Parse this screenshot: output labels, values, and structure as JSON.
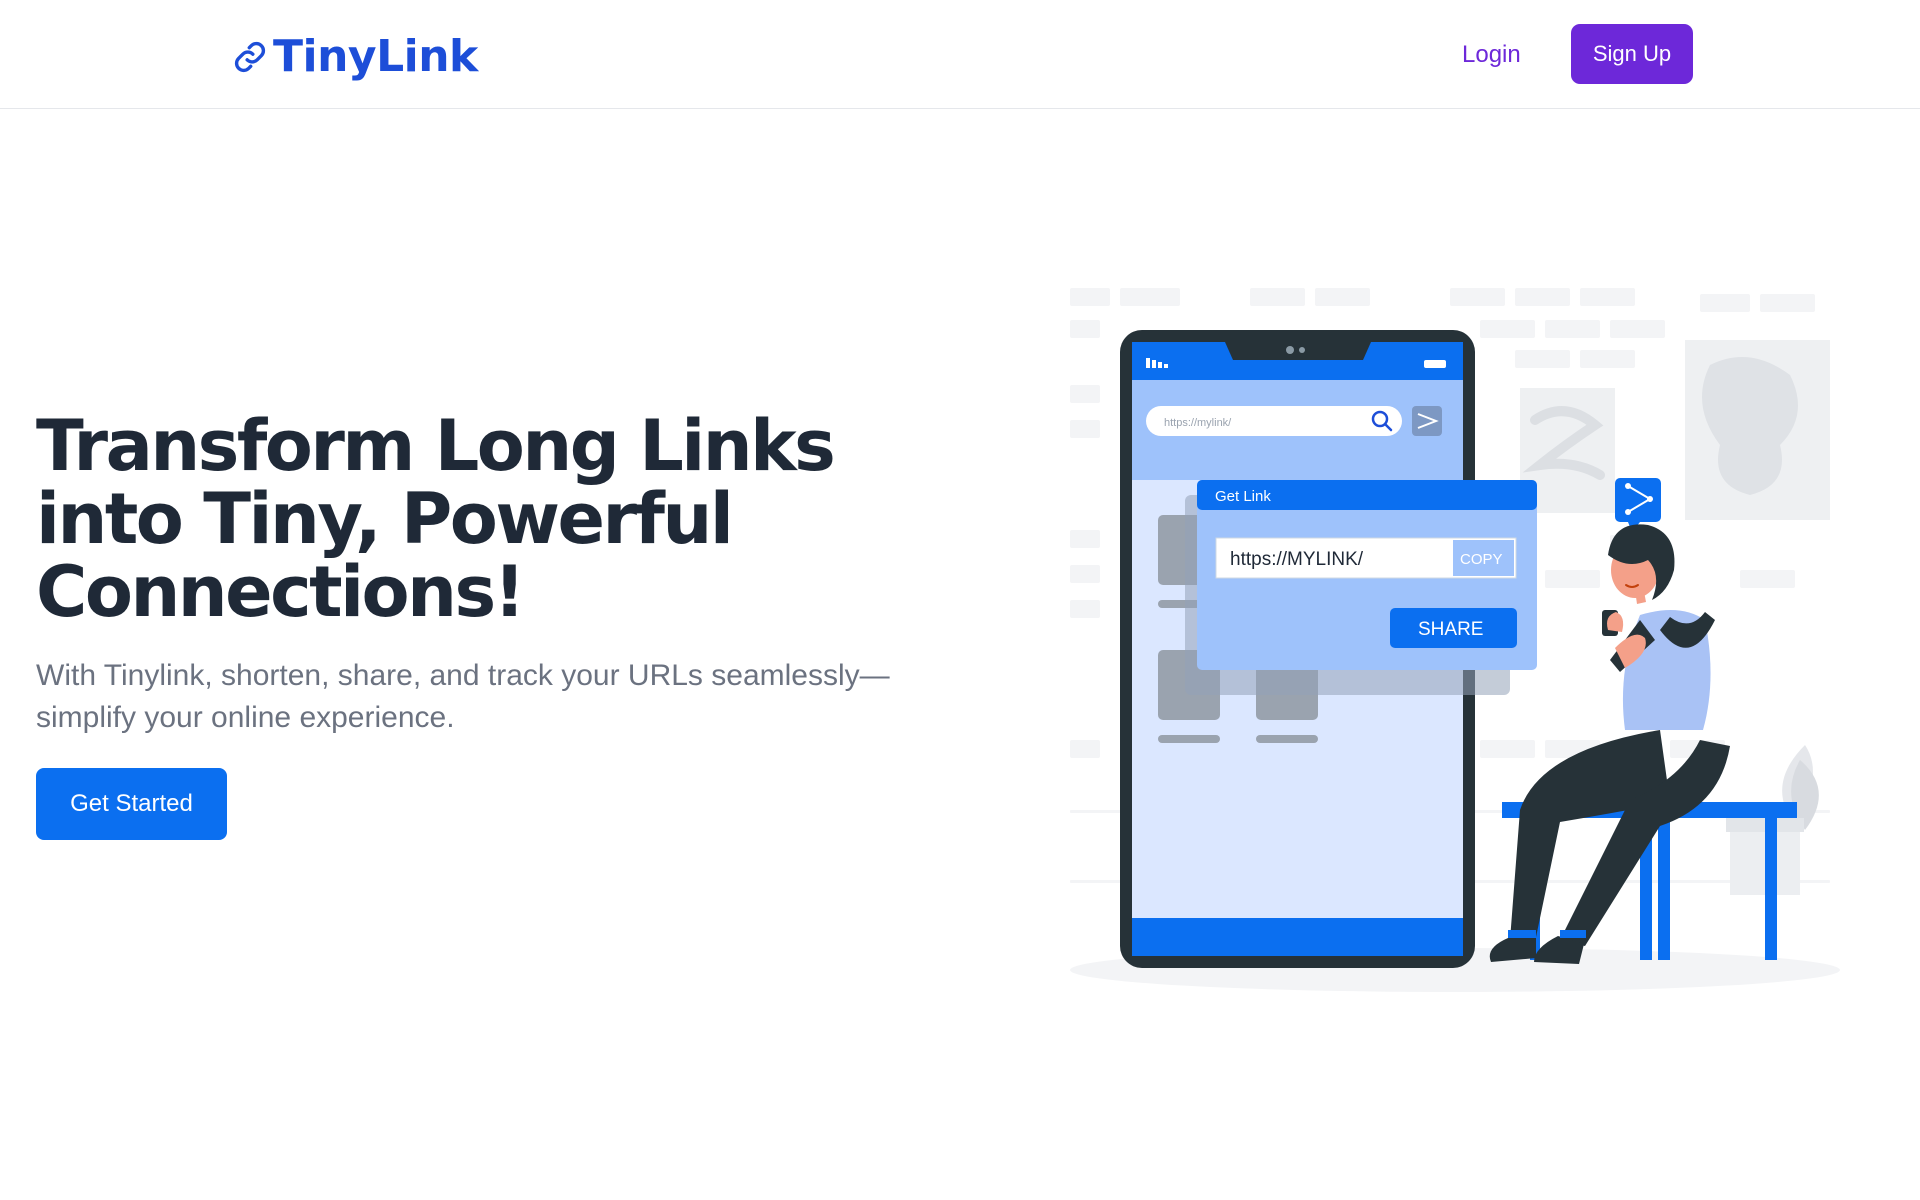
{
  "brand": {
    "name": "TinyLink",
    "icon": "link-icon",
    "color": "#1d4ed8"
  },
  "nav": {
    "login_label": "Login",
    "signup_label": "Sign Up"
  },
  "hero": {
    "title": "Transform Long Links into Tiny, Powerful Connections!",
    "subtitle": "With Tinylink, shorten, share, and track your URLs seamlessly—simplify your online experience.",
    "cta_label": "Get Started"
  },
  "illustration": {
    "phone_search_placeholder": "https://mylink/",
    "dialog_title": "Get Link",
    "dialog_url": "https://MYLINK/",
    "copy_label": "COPY",
    "share_label": "SHARE"
  },
  "colors": {
    "primary_blue": "#0b6ff0",
    "accent_purple": "#6d28d9",
    "heading": "#1f2937",
    "body_text": "#6b7280"
  }
}
